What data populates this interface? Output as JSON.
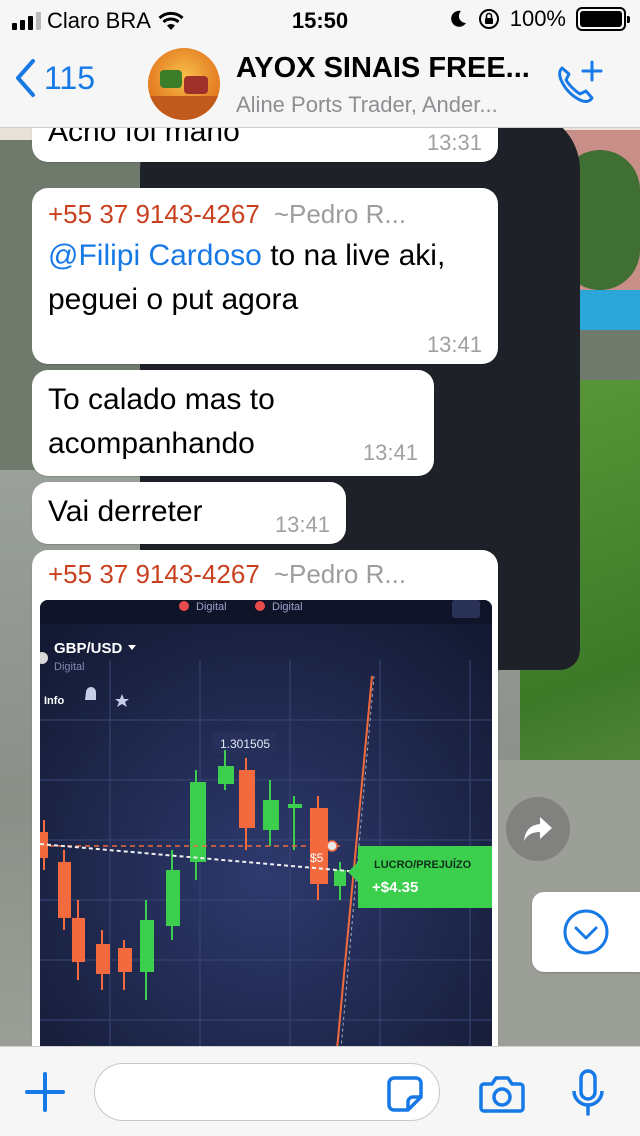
{
  "status_bar": {
    "carrier": "Claro BRA",
    "time": "15:50",
    "battery": "100%"
  },
  "header": {
    "back_count": "115",
    "title": "AYOX SINAIS FREE...",
    "subtitle": "Aline Ports Trader, Ander..."
  },
  "messages": [
    {
      "text": "Acho foi mano",
      "time": "13:31"
    },
    {
      "sender_number": "+55 37 9143-4267",
      "sender_alias": "~Pedro R...",
      "mention": "@Filipi Cardoso",
      "text": " to na live aki, peguei o put agora",
      "time": "13:41"
    },
    {
      "text": "To calado mas to acompanhando",
      "time": "13:41"
    },
    {
      "text": "Vai derreter",
      "time": "13:41"
    },
    {
      "sender_number": "+55 37 9143-4267",
      "sender_alias": "~Pedro R..."
    }
  ],
  "chart_image": {
    "pair": "GBP/USD",
    "type_label": "Digital",
    "info_label": "Info",
    "price_label": "1.301505",
    "amount_label": "$5",
    "profit_title": "LUCRO/PREJUÍZO",
    "profit_value": "+$4.35",
    "tab_labels": [
      "Digital",
      "Digital"
    ]
  },
  "colors": {
    "accent": "#1779e6",
    "sender": "#c9401e",
    "candle_up": "#3ccf4e",
    "candle_down": "#f26a3d"
  }
}
